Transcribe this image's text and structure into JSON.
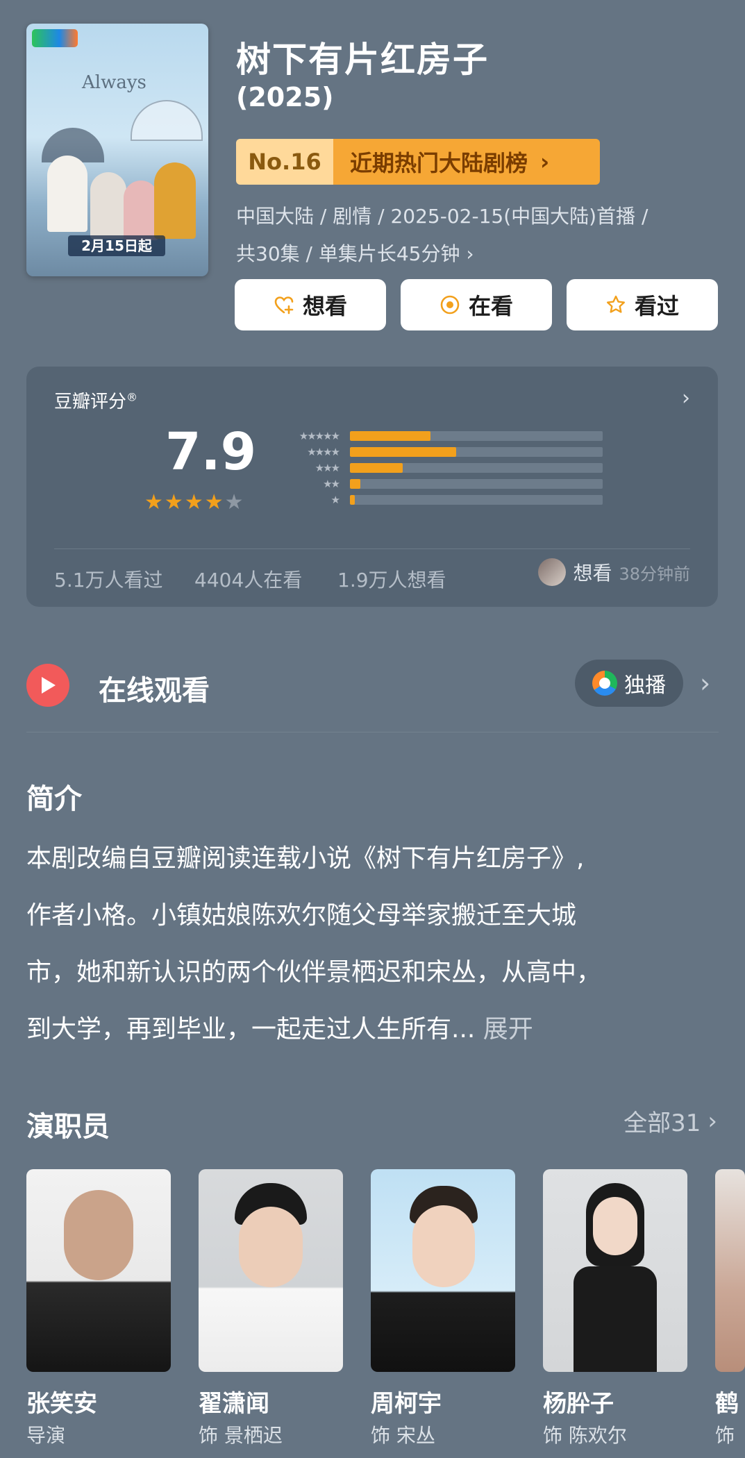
{
  "show": {
    "title": "树下有片红房子",
    "year": "(2025)",
    "rank_no": "No.16",
    "rank_list": "近期热门大陆剧榜",
    "meta_line1": "中国大陆 / 剧情 / 2025-02-15(中国大陆)首播 /",
    "meta_line2": "共30集 / 单集片长45分钟"
  },
  "poster": {
    "art_title": "Always",
    "date_text": "2月15日起"
  },
  "actions": [
    {
      "label": "想看",
      "icon": "heart-plus-icon"
    },
    {
      "label": "在看",
      "icon": "target-icon"
    },
    {
      "label": "看过",
      "icon": "star-outline-icon"
    }
  ],
  "rating": {
    "label": "豆瓣评分",
    "registered": "®",
    "score": "7.9",
    "stars": 4,
    "distribution": [
      {
        "stars": 5,
        "stars_text": "★★★★★",
        "fraction": 0.32
      },
      {
        "stars": 4,
        "stars_text": "★★★★",
        "fraction": 0.42
      },
      {
        "stars": 3,
        "stars_text": "★★★",
        "fraction": 0.21
      },
      {
        "stars": 2,
        "stars_text": "★★",
        "fraction": 0.04
      },
      {
        "stars": 1,
        "stars_text": "★",
        "fraction": 0.02
      }
    ],
    "watched": "5.1万人看过",
    "watching": "4404人在看",
    "want": "1.9万人想看",
    "recent_action": "想看",
    "recent_time": "38分钟前"
  },
  "online": {
    "title": "在线观看",
    "platform_tag": "独播"
  },
  "summary": {
    "title": "简介",
    "line1": "本剧改编自豆瓣阅读连载小说《树下有片红房子》,",
    "line2": "作者小格。小镇姑娘陈欢尔随父母举家搬迁至大城",
    "line3": "市，她和新认识的两个伙伴景栖迟和宋丛，从高中，",
    "line4": "到大学，再到毕业，一起走过人生所有...",
    "more": "展开"
  },
  "cast": {
    "title": "演职员",
    "all_label": "全部31",
    "members": [
      {
        "name": "张笑安",
        "role": "导演"
      },
      {
        "name": "翟潇闻",
        "role": "饰 景栖迟"
      },
      {
        "name": "周柯宇",
        "role": "饰 宋丛"
      },
      {
        "name": "杨肸子",
        "role": "饰 陈欢尔"
      },
      {
        "name": "鹤",
        "role": "饰"
      }
    ]
  },
  "colors": {
    "background": "#657483",
    "card": "#556473",
    "rating_orange": "#f2a01c",
    "rank_light": "#ffd99a",
    "rank_dark": "#f6a735",
    "play_red": "#f25a5a"
  }
}
